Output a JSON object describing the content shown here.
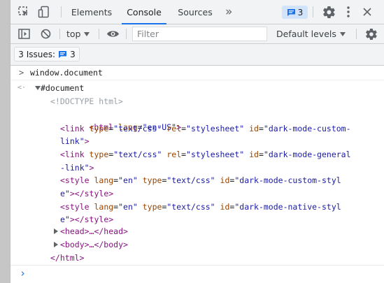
{
  "tabs": {
    "items": [
      {
        "label": "Elements"
      },
      {
        "label": "Console"
      },
      {
        "label": "Sources"
      }
    ],
    "more": "»",
    "issues_count": "3"
  },
  "toolbar": {
    "context": "top",
    "filter_placeholder": "Filter",
    "levels": "Default levels"
  },
  "issues_bar": {
    "label": "3 Issues:",
    "count": "3"
  },
  "console": {
    "command": "window.document",
    "expand_prompt": ">",
    "result_arrow": "<·",
    "root": "#document",
    "doctype": "<!DOCTYPE html>",
    "html_open": {
      "tag_open": "<html",
      "attr": "lang",
      "eq": "=",
      "val": "\"en-US\"",
      "tag_close": ">"
    },
    "lines": [
      {
        "id": "link1",
        "parts": [
          {
            "c": "tag",
            "t": "<link"
          },
          {
            "c": "attr",
            "t": " type"
          },
          {
            "c": "plain",
            "t": "="
          },
          {
            "c": "val",
            "t": "\"text/css\""
          },
          {
            "c": "attr",
            "t": " rel"
          },
          {
            "c": "plain",
            "t": "="
          },
          {
            "c": "val",
            "t": "\"stylesheet\""
          },
          {
            "c": "attr",
            "t": " id"
          },
          {
            "c": "plain",
            "t": "="
          },
          {
            "c": "val",
            "t": "\"dark-mode-custom-"
          }
        ],
        "cont": [
          {
            "c": "val",
            "t": "link\""
          },
          {
            "c": "tag",
            "t": ">"
          }
        ]
      },
      {
        "id": "link2",
        "parts": [
          {
            "c": "tag",
            "t": "<link"
          },
          {
            "c": "attr",
            "t": " type"
          },
          {
            "c": "plain",
            "t": "="
          },
          {
            "c": "val",
            "t": "\"text/css\""
          },
          {
            "c": "attr",
            "t": " rel"
          },
          {
            "c": "plain",
            "t": "="
          },
          {
            "c": "val",
            "t": "\"stylesheet\""
          },
          {
            "c": "attr",
            "t": " id"
          },
          {
            "c": "plain",
            "t": "="
          },
          {
            "c": "val",
            "t": "\"dark-mode-general"
          }
        ],
        "cont": [
          {
            "c": "val",
            "t": "-link\""
          },
          {
            "c": "tag",
            "t": ">"
          }
        ]
      },
      {
        "id": "style1",
        "parts": [
          {
            "c": "tag",
            "t": "<style"
          },
          {
            "c": "attr",
            "t": " lang"
          },
          {
            "c": "plain",
            "t": "="
          },
          {
            "c": "val",
            "t": "\"en\""
          },
          {
            "c": "attr",
            "t": " type"
          },
          {
            "c": "plain",
            "t": "="
          },
          {
            "c": "val",
            "t": "\"text/css\""
          },
          {
            "c": "attr",
            "t": " id"
          },
          {
            "c": "plain",
            "t": "="
          },
          {
            "c": "val",
            "t": "\"dark-mode-custom-styl"
          }
        ],
        "cont": [
          {
            "c": "val",
            "t": "e\""
          },
          {
            "c": "tag",
            "t": "></style>"
          }
        ]
      },
      {
        "id": "style2",
        "parts": [
          {
            "c": "tag",
            "t": "<style"
          },
          {
            "c": "attr",
            "t": " lang"
          },
          {
            "c": "plain",
            "t": "="
          },
          {
            "c": "val",
            "t": "\"en\""
          },
          {
            "c": "attr",
            "t": " type"
          },
          {
            "c": "plain",
            "t": "="
          },
          {
            "c": "val",
            "t": "\"text/css\""
          },
          {
            "c": "attr",
            "t": " id"
          },
          {
            "c": "plain",
            "t": "="
          },
          {
            "c": "val",
            "t": "\"dark-mode-native-styl"
          }
        ],
        "cont": [
          {
            "c": "val",
            "t": "e\""
          },
          {
            "c": "tag",
            "t": "></style>"
          }
        ]
      }
    ],
    "head": "<head>…</head>",
    "body": "<body>…</body>",
    "html_close": "</html>",
    "input_prompt": "›"
  },
  "colors": {
    "accent": "#1a73e8",
    "toolbar_bg": "#f1f3f4",
    "tag": "#881280",
    "attr": "#994500",
    "value": "#1a1aa6"
  },
  "icons": [
    "inspect-icon",
    "device-toggle-icon",
    "issues-icon",
    "gear-icon",
    "kebab-menu-icon",
    "close-icon",
    "sidebar-toggle-icon",
    "clear-console-icon",
    "eye-icon",
    "chevron-down-icon"
  ]
}
